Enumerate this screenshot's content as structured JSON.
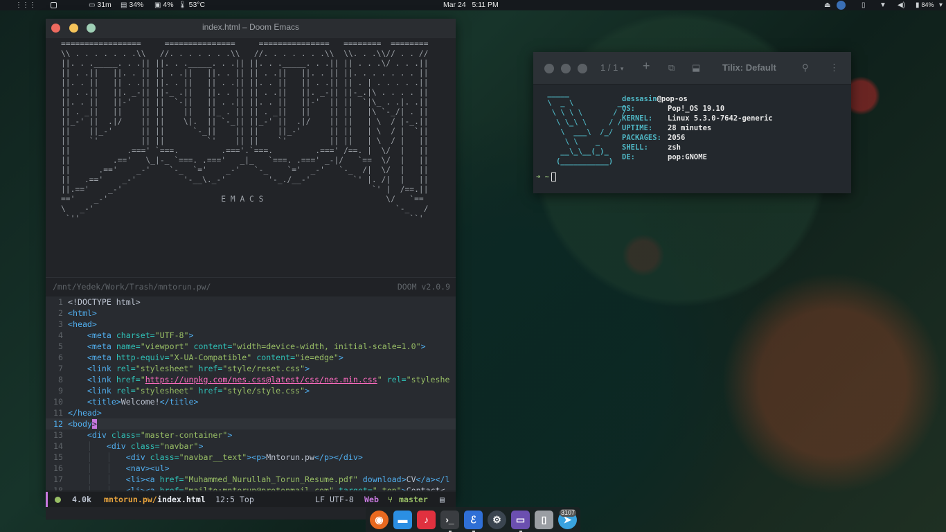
{
  "topbar": {
    "apps_icon": "grid-icon",
    "workspaces_icon": "workspaces-icon",
    "uptime": "31m",
    "memory": "34%",
    "cpu": "4%",
    "temperature": "53°C",
    "date": "Mar 24",
    "time": "5:11 PM",
    "battery": "84%"
  },
  "emacs": {
    "title": "index.html – Doom Emacs",
    "banner_art": "=================     ===============     ===============   ========  ========\n\\\\ . . . . . . .\\\\   //. . . . . . .\\\\   //. . . . . . .\\\\  \\\\. . .\\\\// . . //\n||. . ._____. . .|| ||. . ._____. . .|| ||. . ._____. . .|| || . . .\\/ . . .||\n|| . .||   ||. . || || . .||   ||. . || || . .||   ||. . || ||. . . . . . . ||\n||. . ||   || . .|| ||. . ||   || . .|| ||. . ||   || . .|| || . | . . . . .||\n|| . .||   ||. _-|| ||-_ .||   ||. . || || . .||   ||. _-|| ||-_.|\\ . . . . ||\n||. . ||   ||-'  || ||  `-||   || . .|| ||. . ||   ||-'  || ||  `|\\_ . .|. .||\n|| . _||   ||    || ||    ||   ||_ . || || . _||   ||    || ||   |\\ `-_/| . ||\n||_-' ||  .|/    || ||    \\|.  || `-_|| ||_-' ||  .|/    || ||   | \\  / |-_.||\n||    ||_-'      || ||      `-_||    || ||    ||_-'      || ||   | \\  / |  `||\n||    `'         || ||         `'    || ||    `'         || ||   | \\  / |   ||\n||            .===' `===.         .==='.`===.         .===' /==. |  \\/  |   ||\n||         .=='   \\_|-_ `===. .==='   _|_   `===. .===' _-|/   `==  \\/  |   ||\n||      .=='    _-'    `-_  `='    _-'   `-_    `='  _-'   `-_  /|  \\/  |   ||\n||   .=='    _-'          '-__\\._-'         '-_./__-'         `' |. /|  |   ||\n||.=='    _-'                                                     `' |  /==.||\n=='    _-'                        E M A C S                          \\/   `==\n\\   _-'                                                                `-_   /\n `''                                                                      ``'",
    "footer_path": "/mnt/Yedek/Work/Trash/mntorun.pw/",
    "footer_version": "DOOM v2.0.9",
    "lines": [
      {
        "n": "1",
        "indent": "",
        "parts": [
          {
            "t": "<!DOCTYPE html>",
            "c": "ct"
          }
        ]
      },
      {
        "n": "2",
        "indent": "",
        "parts": [
          {
            "t": "<html>",
            "c": "tag"
          }
        ]
      },
      {
        "n": "3",
        "indent": "",
        "parts": [
          {
            "t": "<head>",
            "c": "tag"
          }
        ]
      },
      {
        "n": "4",
        "indent": "    ",
        "parts": [
          {
            "t": "<meta ",
            "c": "tag"
          },
          {
            "t": "charset=",
            "c": "attr"
          },
          {
            "t": "\"UTF-8\"",
            "c": "str"
          },
          {
            "t": ">",
            "c": "tag"
          }
        ]
      },
      {
        "n": "5",
        "indent": "    ",
        "parts": [
          {
            "t": "<meta ",
            "c": "tag"
          },
          {
            "t": "name=",
            "c": "attr"
          },
          {
            "t": "\"viewport\"",
            "c": "str"
          },
          {
            "t": " content=",
            "c": "attr"
          },
          {
            "t": "\"width=device-width, initial-scale=1.0\"",
            "c": "str"
          },
          {
            "t": ">",
            "c": "tag"
          }
        ]
      },
      {
        "n": "6",
        "indent": "    ",
        "parts": [
          {
            "t": "<meta ",
            "c": "tag"
          },
          {
            "t": "http-equiv=",
            "c": "attr"
          },
          {
            "t": "\"X-UA-Compatible\"",
            "c": "str"
          },
          {
            "t": " content=",
            "c": "attr"
          },
          {
            "t": "\"ie=edge\"",
            "c": "str"
          },
          {
            "t": ">",
            "c": "tag"
          }
        ]
      },
      {
        "n": "7",
        "indent": "    ",
        "parts": [
          {
            "t": "<link ",
            "c": "tag"
          },
          {
            "t": "rel=",
            "c": "attr"
          },
          {
            "t": "\"stylesheet\"",
            "c": "str"
          },
          {
            "t": " href=",
            "c": "attr"
          },
          {
            "t": "\"style/reset.css\"",
            "c": "str"
          },
          {
            "t": ">",
            "c": "tag"
          }
        ]
      },
      {
        "n": "8",
        "indent": "    ",
        "parts": [
          {
            "t": "<link ",
            "c": "tag"
          },
          {
            "t": "href=",
            "c": "attr"
          },
          {
            "t": "\"",
            "c": "str"
          },
          {
            "t": "https://unpkg.com/nes.css@latest/css/nes.min.css",
            "c": "url"
          },
          {
            "t": "\"",
            "c": "str"
          },
          {
            "t": " rel=",
            "c": "attr"
          },
          {
            "t": "\"styleshe",
            "c": "str"
          }
        ]
      },
      {
        "n": "9",
        "indent": "    ",
        "parts": [
          {
            "t": "<link ",
            "c": "tag"
          },
          {
            "t": "rel=",
            "c": "attr"
          },
          {
            "t": "\"stylesheet\"",
            "c": "str"
          },
          {
            "t": " href=",
            "c": "attr"
          },
          {
            "t": "\"style/style.css\"",
            "c": "str"
          },
          {
            "t": ">",
            "c": "tag"
          }
        ]
      },
      {
        "n": "10",
        "indent": "    ",
        "parts": [
          {
            "t": "<title>",
            "c": "tag"
          },
          {
            "t": "Welcome!",
            "c": "ct"
          },
          {
            "t": "</title>",
            "c": "tag"
          }
        ]
      },
      {
        "n": "11",
        "indent": "",
        "parts": [
          {
            "t": "</head>",
            "c": "tag"
          }
        ]
      },
      {
        "n": "12",
        "indent": "",
        "cur": true,
        "parts": [
          {
            "t": "<body",
            "c": "tag"
          },
          {
            "t": ">",
            "c": "cursor-blk"
          }
        ]
      },
      {
        "n": "13",
        "indent": "    ",
        "parts": [
          {
            "t": "<div ",
            "c": "tag"
          },
          {
            "t": "class=",
            "c": "attr"
          },
          {
            "t": "\"master-container\"",
            "c": "str"
          },
          {
            "t": ">",
            "c": "tag"
          }
        ]
      },
      {
        "n": "14",
        "indent": "    │   ",
        "parts": [
          {
            "t": "<div ",
            "c": "tag"
          },
          {
            "t": "class=",
            "c": "attr"
          },
          {
            "t": "\"navbar\"",
            "c": "str"
          },
          {
            "t": ">",
            "c": "tag"
          }
        ]
      },
      {
        "n": "15",
        "indent": "    │   │   ",
        "parts": [
          {
            "t": "<div ",
            "c": "tag"
          },
          {
            "t": "class=",
            "c": "attr"
          },
          {
            "t": "\"navbar__text\"",
            "c": "str"
          },
          {
            "t": "><p>",
            "c": "tag"
          },
          {
            "t": "Mntorun.pw",
            "c": "ct"
          },
          {
            "t": "</p></div>",
            "c": "tag"
          }
        ]
      },
      {
        "n": "16",
        "indent": "    │   │   ",
        "parts": [
          {
            "t": "<nav><ul>",
            "c": "tag"
          }
        ]
      },
      {
        "n": "17",
        "indent": "    │   │   ",
        "parts": [
          {
            "t": "<li><a ",
            "c": "tag"
          },
          {
            "t": "href=",
            "c": "attr"
          },
          {
            "t": "\"Muhammed_Nurullah_Torun_Resume.pdf\"",
            "c": "str"
          },
          {
            "t": " download>",
            "c": "tag"
          },
          {
            "t": "CV",
            "c": "ct"
          },
          {
            "t": "</a></l",
            "c": "tag"
          }
        ]
      },
      {
        "n": "18",
        "indent": "    │   │   ",
        "parts": [
          {
            "t": "<li><a ",
            "c": "tag"
          },
          {
            "t": "href=",
            "c": "attr"
          },
          {
            "t": "\"mailto:mntorun@protonmail.com\"",
            "c": "str"
          },
          {
            "t": " target=",
            "c": "attr"
          },
          {
            "t": "\"_top\"",
            "c": "str"
          },
          {
            "t": ">",
            "c": "tag"
          },
          {
            "t": "Contact<",
            "c": "ct"
          }
        ]
      }
    ],
    "modeline": {
      "size": "4.0k",
      "dir": "mntorun.pw/",
      "file": "index.html",
      "position": "12:5 Top",
      "encoding": "LF UTF-8",
      "mode": "Web",
      "git_icon": "git-branch-icon",
      "branch": "master",
      "doc_icon": "document-icon"
    }
  },
  "tilix": {
    "counter": "1 / 1",
    "title": "Tilix: Default",
    "logo_art": " _____\n \\  _ \\          __\n  \\ \\ \\ \\       / /\n   \\ \\_\\ \\     / /\n    \\  ___\\  /_/\n     \\ \\    _\n    __\\_\\__(_)_\n   (___________)",
    "user": "dessasin",
    "host": "@pop-os",
    "info": [
      {
        "k": "OS:",
        "v": "Pop!_OS 19.10"
      },
      {
        "k": "KERNEL:",
        "v": "Linux 5.3.0-7642-generic"
      },
      {
        "k": "UPTIME:",
        "v": "28 minutes"
      },
      {
        "k": "PACKAGES:",
        "v": "2056"
      },
      {
        "k": "SHELL:",
        "v": "zsh"
      },
      {
        "k": "DE:",
        "v": "pop:GNOME"
      }
    ],
    "prompt": "➜ ~"
  },
  "dock": {
    "apps": [
      {
        "name": "firefox",
        "icon": "firefox-icon",
        "color": "#e8691f"
      },
      {
        "name": "files",
        "icon": "folder-icon",
        "color": "#2b8fe3"
      },
      {
        "name": "music",
        "icon": "music-icon",
        "color": "#e0313f"
      },
      {
        "name": "terminal",
        "icon": "terminal-icon",
        "color": "#3a3d41"
      },
      {
        "name": "emacs",
        "icon": "emacs-icon",
        "color": "#2f6fd6"
      },
      {
        "name": "steam",
        "icon": "steam-icon",
        "color": "#3b4550"
      },
      {
        "name": "tilix",
        "icon": "tilix-icon",
        "color": "#6b4fb0"
      },
      {
        "name": "trash",
        "icon": "trash-icon",
        "color": "#9a9ea3"
      },
      {
        "name": "telegram",
        "icon": "telegram-icon",
        "color": "#3aa2df"
      }
    ],
    "telegram_badge": "3107"
  }
}
